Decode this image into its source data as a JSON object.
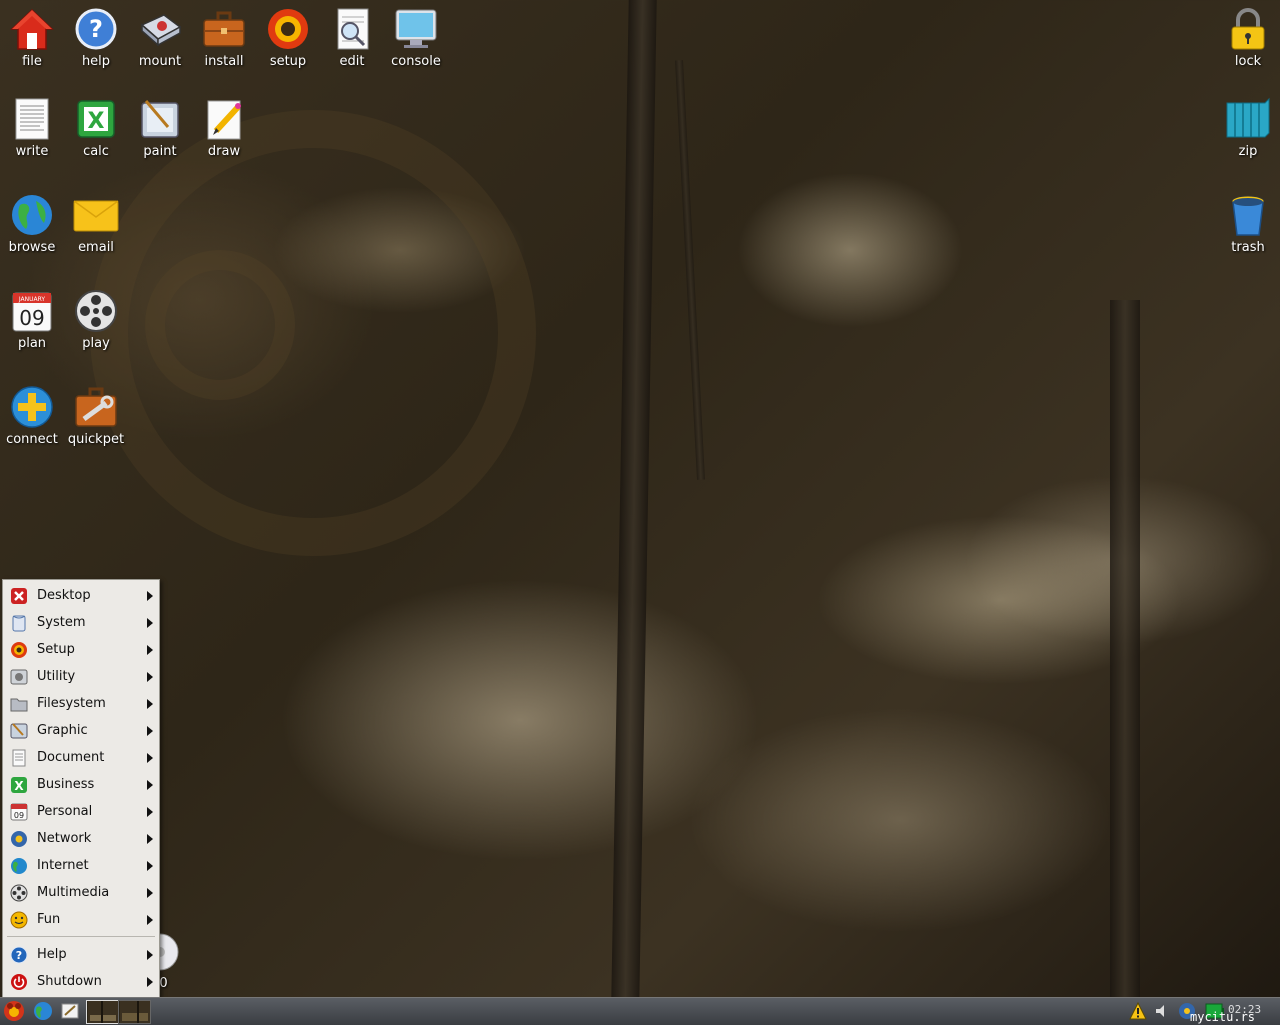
{
  "desktop": {
    "icons_left": [
      {
        "label": "file",
        "icon": "home-icon"
      },
      {
        "label": "help",
        "icon": "help-icon"
      },
      {
        "label": "mount",
        "icon": "drive-icon"
      },
      {
        "label": "install",
        "icon": "briefcase-icon"
      },
      {
        "label": "setup",
        "icon": "setup-target-icon"
      },
      {
        "label": "edit",
        "icon": "text-editor-icon"
      },
      {
        "label": "console",
        "icon": "monitor-icon"
      },
      {
        "label": "write",
        "icon": "document-icon"
      },
      {
        "label": "calc",
        "icon": "spreadsheet-icon"
      },
      {
        "label": "paint",
        "icon": "paint-icon"
      },
      {
        "label": "draw",
        "icon": "draw-pencil-icon"
      },
      {
        "label": "browse",
        "icon": "globe-icon"
      },
      {
        "label": "email",
        "icon": "envelope-icon"
      },
      {
        "label": "plan",
        "icon": "calendar-icon"
      },
      {
        "label": "play",
        "icon": "film-reel-icon"
      },
      {
        "label": "connect",
        "icon": "connect-plus-icon"
      },
      {
        "label": "quickpet",
        "icon": "toolbox-icon"
      }
    ],
    "icons_right": [
      {
        "label": "lock",
        "icon": "padlock-icon"
      },
      {
        "label": "zip",
        "icon": "archive-icon"
      },
      {
        "label": "trash",
        "icon": "trash-can-icon"
      }
    ],
    "partial_drive_label": "r0",
    "calendar_month": "JANUARY",
    "calendar_day": "09"
  },
  "start_menu": {
    "items": [
      {
        "label": "Desktop",
        "icon": "desktop-x-icon",
        "color": "#cc2222"
      },
      {
        "label": "System",
        "icon": "system-icon",
        "color": "#5577aa"
      },
      {
        "label": "Setup",
        "icon": "setup-icon",
        "color": "#dd5500"
      },
      {
        "label": "Utility",
        "icon": "utility-icon",
        "color": "#777777"
      },
      {
        "label": "Filesystem",
        "icon": "folder-icon",
        "color": "#8a8a8a"
      },
      {
        "label": "Graphic",
        "icon": "graphic-icon",
        "color": "#557799"
      },
      {
        "label": "Document",
        "icon": "document-icon",
        "color": "#999999"
      },
      {
        "label": "Business",
        "icon": "business-icon",
        "color": "#22aa44"
      },
      {
        "label": "Personal",
        "icon": "calendar-icon",
        "color": "#cc3333"
      },
      {
        "label": "Network",
        "icon": "network-icon",
        "color": "#3366aa"
      },
      {
        "label": "Internet",
        "icon": "globe-icon",
        "color": "#2288cc"
      },
      {
        "label": "Multimedia",
        "icon": "film-reel-icon",
        "color": "#555555"
      },
      {
        "label": "Fun",
        "icon": "smiley-icon",
        "color": "#ee9900"
      }
    ],
    "bottom_items": [
      {
        "label": "Help",
        "icon": "help-icon",
        "color": "#2266bb"
      },
      {
        "label": "Shutdown",
        "icon": "power-icon",
        "color": "#cc1111"
      }
    ]
  },
  "taskbar": {
    "tray_text": "mycitu.rs",
    "clock": "02:23"
  }
}
